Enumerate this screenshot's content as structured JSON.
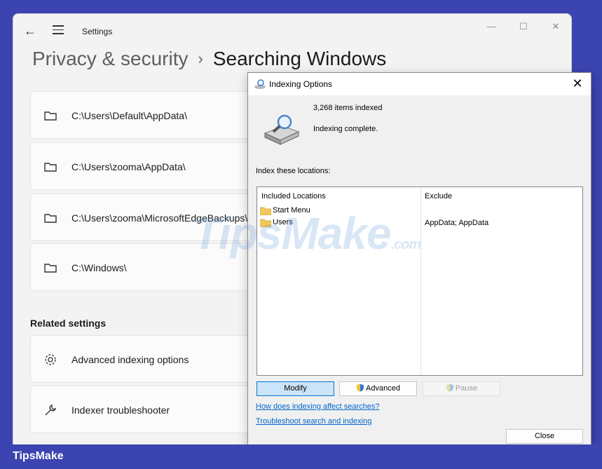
{
  "settings": {
    "app_title": "Settings",
    "breadcrumb_parent": "Privacy & security",
    "breadcrumb_sep": "›",
    "breadcrumb_current": "Searching Windows",
    "excluded_folders": [
      "C:\\Users\\Default\\AppData\\",
      "C:\\Users\\zooma\\AppData\\",
      "C:\\Users\\zooma\\MicrosoftEdgeBackups\\",
      "C:\\Windows\\"
    ],
    "related_title": "Related settings",
    "related": [
      {
        "label": "Advanced indexing options",
        "icon": "gear-icon"
      },
      {
        "label": "Indexer troubleshooter",
        "icon": "wrench-icon"
      }
    ]
  },
  "dialog": {
    "title": "Indexing Options",
    "items_indexed": "3,268 items indexed",
    "status": "Indexing complete.",
    "locations_label": "Index these locations:",
    "col_included": "Included Locations",
    "col_exclude": "Exclude",
    "locations": [
      {
        "name": "Start Menu",
        "exclude": ""
      },
      {
        "name": "Users",
        "exclude": "AppData; AppData"
      }
    ],
    "buttons": {
      "modify": "Modify",
      "advanced": "Advanced",
      "pause": "Pause",
      "close": "Close"
    },
    "links": [
      "How does indexing affect searches?",
      "Troubleshoot search and indexing"
    ]
  },
  "watermark": {
    "main": "TipsMake",
    "suffix": ".com"
  },
  "brand": "TipsMake",
  "colors": {
    "accent": "#3b44b0",
    "link": "#0066cc",
    "selected_button": "#cce4f7"
  }
}
